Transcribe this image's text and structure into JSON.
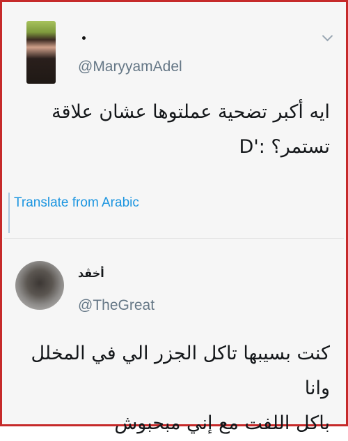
{
  "tweet1": {
    "handle": "@MaryyamAdel",
    "text_line1": "ايه أكبر تضحية عملتوها عشان علاقة",
    "text_line2": "تستمر؟ :'D",
    "translate_label": "Translate from Arabic",
    "avatar_icon": "profile-photo-icon",
    "menu_icon": "chevron-down-icon"
  },
  "tweet2": {
    "display_name": "أخڤد",
    "handle": "@TheGreat",
    "text_line1": "كنت بسيبها تاكل الجزر الي في المخلل وانا",
    "text_line2": "باكل اللفت مع إني مبحبوش",
    "avatar_icon": "profile-photo-icon"
  },
  "colors": {
    "border": "#c62a2a",
    "link": "#1b95e0",
    "handle": "#657786"
  }
}
